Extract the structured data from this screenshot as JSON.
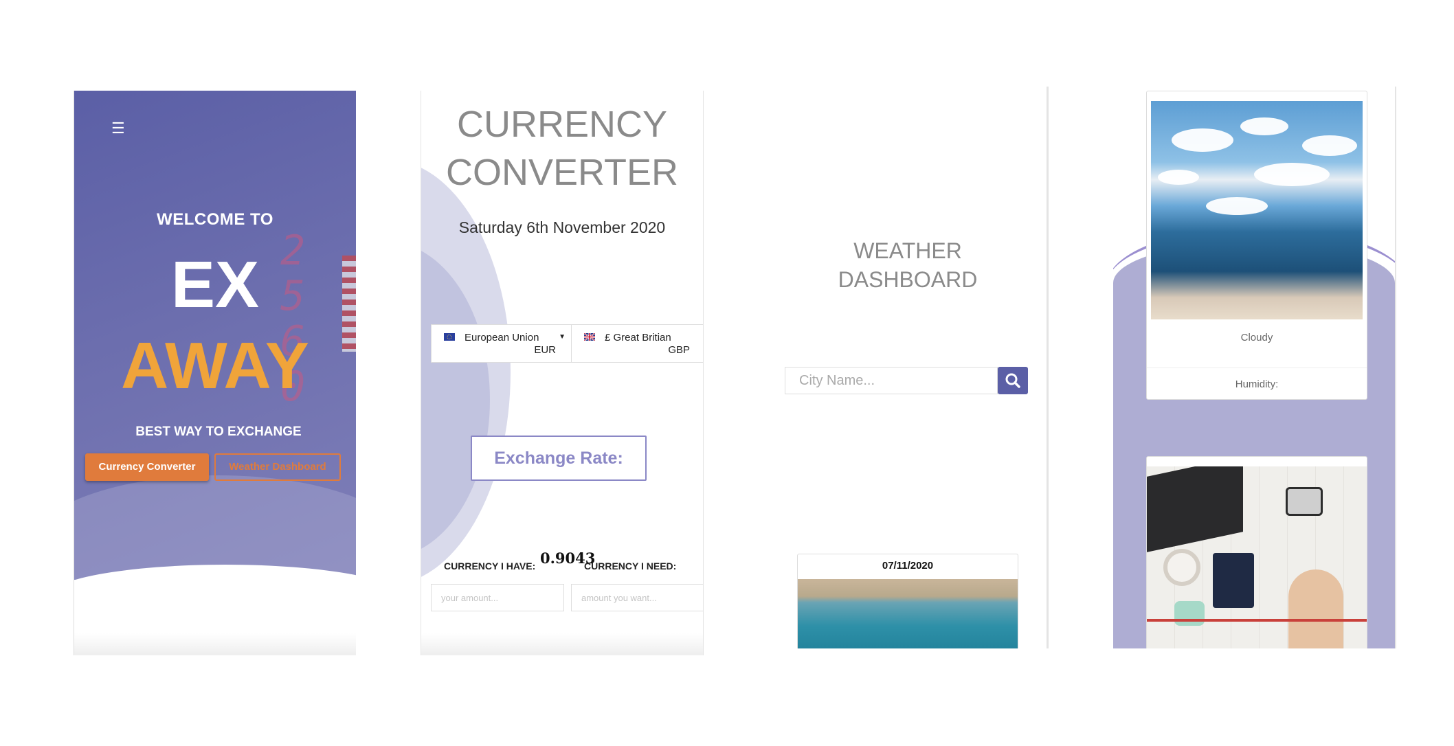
{
  "home": {
    "menu_icon": "☰",
    "welcome": "WELCOME TO",
    "brand_top": "EX",
    "brand_bottom": "AWAY",
    "tagline": "BEST WAY TO EXCHANGE",
    "btn_currency": "Currency Converter",
    "btn_weather": "Weather Dashboard",
    "bg_digits": [
      "2",
      "5",
      "6",
      "0"
    ]
  },
  "currency": {
    "title_line1": "CURRENCY",
    "title_line2": "CONVERTER",
    "date": "Saturday 6th November 2020",
    "from": {
      "name": "European Union",
      "code": "EUR"
    },
    "to": {
      "name": "£ Great Britian",
      "code": "GBP"
    },
    "rate_label": "Exchange Rate:",
    "have_label": "CURRENCY I HAVE:",
    "rate_value": "0.9043",
    "need_label": "CURRENCY I NEED:",
    "have_placeholder": "your amount...",
    "need_placeholder": "amount you want..."
  },
  "weather": {
    "title_line1": "WEATHER",
    "title_line2": "DASHBOARD",
    "search_placeholder": "City Name...",
    "card_date": "07/11/2020"
  },
  "weather_cards": {
    "condition": "Cloudy",
    "humidity_label": "Humidity:"
  },
  "colors": {
    "brand_purple": "#5b5fa6",
    "accent_orange": "#e07b3c",
    "away_gold": "#f0a43a",
    "rate_purple": "#8b88c6"
  }
}
